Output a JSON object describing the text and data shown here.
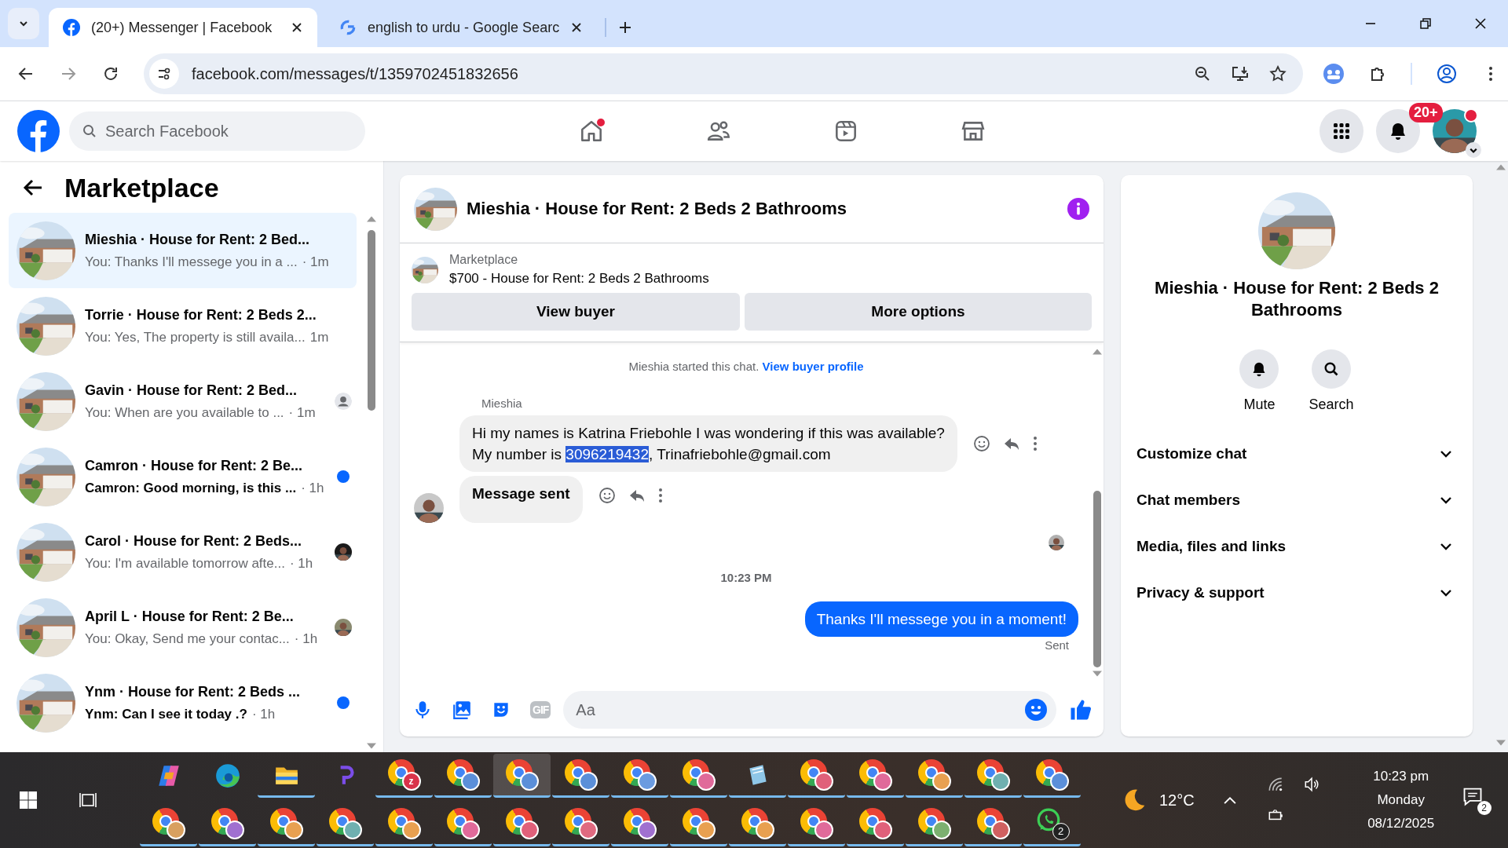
{
  "browser": {
    "tabs": [
      {
        "title": "(20+) Messenger | Facebook",
        "selected": true,
        "kind": "facebook"
      },
      {
        "title": "english to urdu - Google Searc",
        "selected": false,
        "kind": "google"
      }
    ],
    "address": "facebook.com/messages/t/1359702451832656"
  },
  "facebook": {
    "search": {
      "placeholder": "Search Facebook"
    },
    "nav": [
      {
        "kind": "home",
        "dot": true
      },
      {
        "kind": "friends",
        "dot": false
      },
      {
        "kind": "video",
        "dot": false
      },
      {
        "kind": "marketplace",
        "dot": false
      }
    ],
    "notifications_badge": "20+"
  },
  "sidebar": {
    "title": "Marketplace",
    "conversations": [
      {
        "title": "Mieshia · House for Rent: 2 Bed...",
        "preview": "You: Thanks I'll messege you in a ...",
        "time": "· 1m",
        "unread": false,
        "selected": true,
        "kind": "none"
      },
      {
        "title": "Torrie · House for Rent: 2 Beds 2...",
        "preview": "You: Yes, The property is still availa...",
        "time": "1m",
        "unread": false,
        "selected": false,
        "kind": "none"
      },
      {
        "title": "Gavin · House for Rent: 2 Bed...",
        "preview": "You: When are you available to ...",
        "time": "· 1m",
        "unread": false,
        "selected": false,
        "kind": "person"
      },
      {
        "title": "Camron · House for Rent: 2 Be...",
        "preview": "Camron: Good morning, is this ...",
        "time": "· 1h",
        "unread": true,
        "selected": false,
        "kind": "dot"
      },
      {
        "title": "Carol · House for Rent: 2 Beds...",
        "preview": "You: I'm available tomorrow afte...",
        "time": "· 1h",
        "unread": false,
        "selected": false
      },
      {
        "title": "April L · House for Rent: 2 Be...",
        "preview": "You: Okay, Send me your contac...",
        "time": "· 1h",
        "unread": false,
        "selected": false
      },
      {
        "title": "Ynm · House for Rent: 2 Beds ...",
        "preview": "Ynm: Can I see it today .?",
        "time": "· 1h",
        "unread": true,
        "selected": false,
        "kind": "dot"
      }
    ]
  },
  "chat": {
    "title": "Mieshia · House for Rent: 2 Beds 2 Bathrooms",
    "listing": {
      "source": "Marketplace",
      "name": "$700 - House for Rent: 2 Beds 2 Bathrooms"
    },
    "buttons": [
      "View buyer",
      "More options"
    ],
    "started": {
      "text": "Mieshia started this chat.",
      "link": "View buyer profile"
    },
    "sender": "Mieshia",
    "messages": [
      {
        "kind": "incoming",
        "lines": [
          "Hi my names is Katrina Friebohle I was wondering if this was available?"
        ],
        "before": "My number is ",
        "highlight": "3096219432",
        "after": ", Trinafriebohle@gmail.com"
      },
      {
        "kind": "incoming_bold",
        "text": "Message sent"
      },
      {
        "kind": "seen"
      },
      {
        "kind": "time",
        "text": "10:23 PM"
      },
      {
        "kind": "outgoing",
        "text": "Thanks I'll messege you in a moment!"
      },
      {
        "kind": "status",
        "text": "Sent"
      }
    ],
    "composer": {
      "placeholder": "Aa",
      "gif_label": "GIF"
    }
  },
  "info": {
    "title": "Mieshia · House for Rent: 2 Beds 2 Bathrooms",
    "actions": [
      {
        "kind": "mute",
        "label": "Mute"
      },
      {
        "kind": "search",
        "label": "Search"
      }
    ],
    "sections": [
      {
        "label": "Customize chat",
        "expanded": false
      },
      {
        "label": "Chat members",
        "expanded": false
      },
      {
        "label": "Media, files and links",
        "expanded": false
      },
      {
        "label": "Privacy & support",
        "expanded": false
      }
    ]
  },
  "taskbar": {
    "rows": [
      [
        {
          "kind": "copilot",
          "open": false,
          "selected": false
        },
        {
          "kind": "edge",
          "open": false,
          "selected": false
        },
        {
          "kind": "files",
          "open": true,
          "selected": false
        },
        {
          "kind": "purple-app",
          "open": false,
          "selected": false
        },
        {
          "kind": "browser",
          "color": "#d9334a",
          "letter": "z",
          "open": true,
          "selected": false
        },
        {
          "kind": "browser",
          "color": "#5b8fd9",
          "open": true,
          "selected": false
        },
        {
          "kind": "browser",
          "color": "#5b8fd9",
          "open": true,
          "selected": true
        },
        {
          "kind": "browser",
          "color": "#5b8fd9",
          "open": true,
          "selected": false
        },
        {
          "kind": "browser",
          "color": "#6b9be0",
          "open": true,
          "selected": false
        },
        {
          "kind": "browser",
          "color": "#e06a9a",
          "open": true,
          "selected": false
        },
        {
          "kind": "notes",
          "open": true,
          "selected": false
        },
        {
          "kind": "browser",
          "color": "#e0607a",
          "open": true,
          "selected": false
        },
        {
          "kind": "browser",
          "color": "#e06a9a",
          "open": true,
          "selected": false
        },
        {
          "kind": "browser",
          "color": "#e8a050",
          "open": true,
          "selected": false
        },
        {
          "kind": "browser",
          "color": "#6fb0b0",
          "open": true,
          "selected": false
        },
        {
          "kind": "browser",
          "color": "#5b8fd9",
          "open": true,
          "selected": false
        }
      ],
      [
        {
          "kind": "browser",
          "color": "#d8a060",
          "open": true,
          "selected": false
        },
        {
          "kind": "browser",
          "color": "#a070d0",
          "open": true,
          "selected": false
        },
        {
          "kind": "browser",
          "color": "#e8a050",
          "open": true,
          "selected": false
        },
        {
          "kind": "browser",
          "color": "#6fb0b0",
          "open": true,
          "selected": false
        },
        {
          "kind": "browser",
          "color": "#e8a050",
          "open": true,
          "selected": false
        },
        {
          "kind": "browser",
          "color": "#e06a9a",
          "open": true,
          "selected": false
        },
        {
          "kind": "browser",
          "color": "#e0607a",
          "open": true,
          "selected": false
        },
        {
          "kind": "browser",
          "color": "#e06a80",
          "open": true,
          "selected": false
        },
        {
          "kind": "browser",
          "color": "#a070d0",
          "open": true,
          "selected": false
        },
        {
          "kind": "browser",
          "color": "#e8a050",
          "open": true,
          "selected": false
        },
        {
          "kind": "browser",
          "color": "#e8a050",
          "open": true,
          "selected": false
        },
        {
          "kind": "browser",
          "color": "#e06a9a",
          "open": true,
          "selected": false
        },
        {
          "kind": "browser",
          "color": "#e0607a",
          "open": true,
          "selected": false
        },
        {
          "kind": "browser",
          "color": "#7cb070",
          "open": true,
          "selected": false
        },
        {
          "kind": "browser",
          "color": "#d06060",
          "open": true,
          "selected": false
        },
        {
          "kind": "whatsapp",
          "badge": "2",
          "open": true,
          "selected": false
        }
      ]
    ],
    "weather": "12°C",
    "time": "10:23 pm",
    "day": "Monday",
    "date": "08/12/2025",
    "notification_badge": "2"
  }
}
